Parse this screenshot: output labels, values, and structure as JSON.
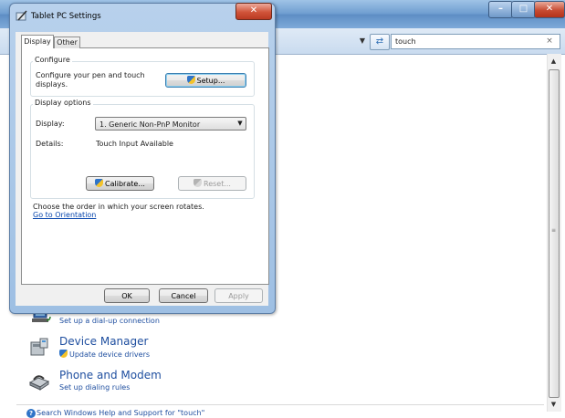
{
  "background_window": {
    "search": {
      "value": "touch"
    },
    "items": [
      {
        "title": "",
        "link": "Set up a dial-up connection"
      },
      {
        "title": "Device Manager",
        "link": "Update device drivers"
      },
      {
        "title": "Phone and Modem",
        "link": "Set up dialing rules"
      }
    ],
    "help_link": "Search Windows Help and Support for \"touch\""
  },
  "dialog": {
    "title": "Tablet PC Settings",
    "tabs": [
      {
        "label": "Display"
      },
      {
        "label": "Other"
      }
    ],
    "configure": {
      "group_label": "Configure",
      "text_line1": "Configure your pen and touch",
      "text_line2": "displays.",
      "setup_button": "Setup..."
    },
    "display_options": {
      "group_label": "Display options",
      "display_label": "Display:",
      "display_value": "1. Generic Non-PnP Monitor",
      "details_label": "Details:",
      "details_value": "Touch Input Available",
      "calibrate_button": "Calibrate...",
      "reset_button": "Reset..."
    },
    "orientation": {
      "text": "Choose the order in which your screen rotates.",
      "link": "Go to Orientation"
    },
    "buttons": {
      "ok": "OK",
      "cancel": "Cancel",
      "apply": "Apply"
    }
  }
}
